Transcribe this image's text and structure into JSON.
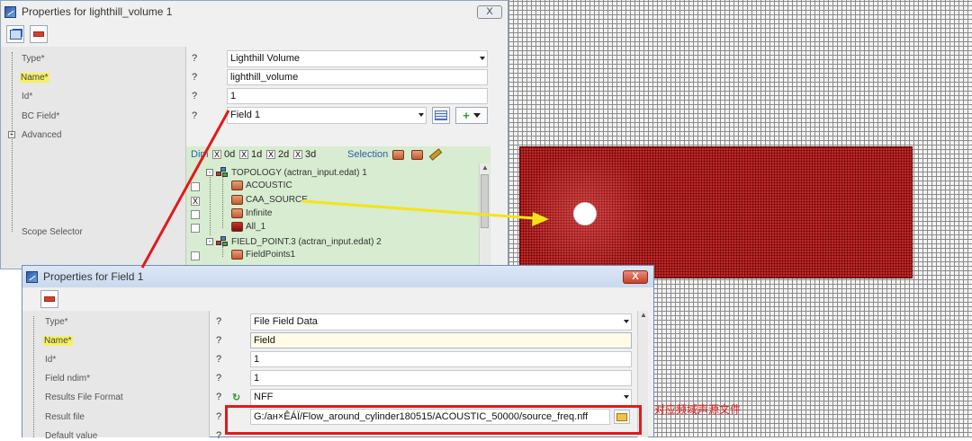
{
  "mesh": {
    "colors": {
      "mesh_red": "#c22a2a",
      "grid": "#8a8a8a"
    }
  },
  "win1": {
    "title": "Properties for lighthill_volume 1",
    "close_label": "X",
    "fields": [
      {
        "label": "Type*",
        "q": "?",
        "value": "Lighthill Volume"
      },
      {
        "label": "Name*",
        "q": "?",
        "value": "lighthill_volume"
      },
      {
        "label": "Id*",
        "q": "?",
        "value": "1"
      },
      {
        "label": "BC Field*",
        "q": "?",
        "value": "Field 1"
      }
    ],
    "advanced": {
      "expander": "+",
      "label": "Advanced"
    },
    "scope_selector": "Scope Selector",
    "dim": {
      "label": "Dim",
      "options": [
        {
          "check": "X",
          "label": "0d"
        },
        {
          "check": "X",
          "label": "1d"
        },
        {
          "check": "X",
          "label": "2d"
        },
        {
          "check": "X",
          "label": "3d"
        }
      ],
      "selection_label": "Selection"
    },
    "tree": [
      {
        "label": "TOPOLOGY (actran_input.edat) 1",
        "expander": "-"
      },
      {
        "label": "ACOUSTIC",
        "check": ""
      },
      {
        "label": "CAA_SOURCE",
        "check": "X"
      },
      {
        "label": "Infinite",
        "check": ""
      },
      {
        "label": "All_1",
        "check": ""
      },
      {
        "label": "FIELD_POINT.3 (actran_input.edat) 2",
        "expander": "-"
      },
      {
        "label": "FieldPoints1",
        "check": ""
      }
    ]
  },
  "win2": {
    "title": "Properties for Field 1",
    "close_label": "X",
    "fields": [
      {
        "label": "Type*",
        "q": "?",
        "value": "File Field Data"
      },
      {
        "label": "Name*",
        "q": "?",
        "value": "Field"
      },
      {
        "label": "Id*",
        "q": "?",
        "value": "1"
      },
      {
        "label": "Field ndim*",
        "q": "?",
        "value": "1"
      },
      {
        "label": "Results File Format",
        "q": "?",
        "value": "NFF"
      },
      {
        "label": "Result file",
        "q": "?",
        "value": "G:/ан×ÊÁÏ/Flow_around_cylinder180515/ACOUSTIC_50000/source_freq.nff"
      },
      {
        "label": "Default value",
        "q": "?",
        "value": ""
      }
    ]
  },
  "annotation": {
    "text": "对应频域声源文件",
    "color": "#e31b1b"
  }
}
